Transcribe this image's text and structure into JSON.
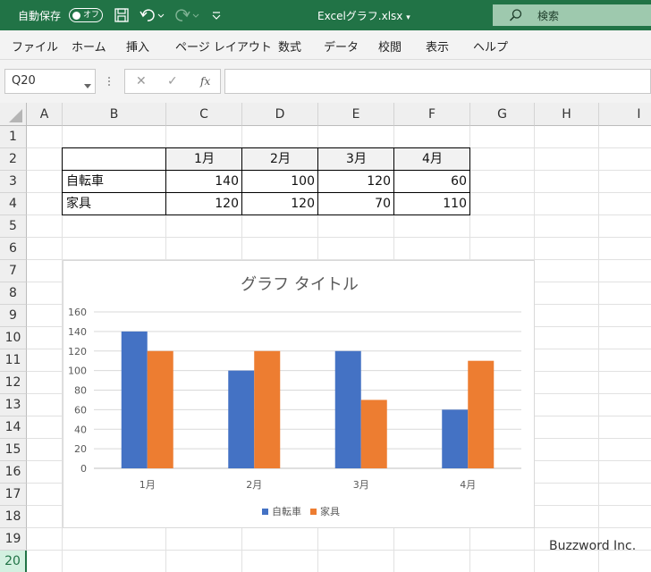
{
  "titlebar": {
    "autosave_label": "自動保存",
    "autosave_state": "オフ",
    "filename": "Excelグラフ.xlsx",
    "search_label": "検索",
    "accent": "#217346"
  },
  "ribbon": {
    "tabs": [
      "ファイル",
      "ホーム",
      "挿入",
      "ページ レイアウト",
      "数式",
      "データ",
      "校閲",
      "表示",
      "ヘルプ"
    ]
  },
  "formula_bar": {
    "name_box": "Q20",
    "fx_label": "fx",
    "formula": ""
  },
  "grid": {
    "columns": [
      "A",
      "B",
      "C",
      "D",
      "E",
      "F",
      "G",
      "H",
      "I"
    ],
    "rows": [
      "1",
      "2",
      "3",
      "4",
      "5",
      "6",
      "7",
      "8",
      "9",
      "10",
      "11",
      "12",
      "13",
      "14",
      "15",
      "16",
      "17",
      "18",
      "19",
      "20"
    ],
    "active_row": "20"
  },
  "table": {
    "header": [
      "",
      "1月",
      "2月",
      "3月",
      "4月"
    ],
    "rows": [
      {
        "label": "自転車",
        "values": [
          "140",
          "100",
          "120",
          "60"
        ]
      },
      {
        "label": "家具",
        "values": [
          "120",
          "120",
          "70",
          "110"
        ]
      }
    ]
  },
  "chart_data": {
    "type": "bar",
    "title": "グラフ タイトル",
    "categories": [
      "1月",
      "2月",
      "3月",
      "4月"
    ],
    "series": [
      {
        "name": "自転車",
        "values": [
          140,
          100,
          120,
          60
        ],
        "color": "#4472c4"
      },
      {
        "name": "家具",
        "values": [
          120,
          120,
          70,
          110
        ],
        "color": "#ed7d31"
      }
    ],
    "ylim": [
      0,
      160
    ],
    "yticks": [
      "0",
      "20",
      "40",
      "60",
      "80",
      "100",
      "120",
      "140",
      "160"
    ],
    "grid": true,
    "legend_position": "bottom"
  },
  "watermark": "Buzzword Inc."
}
